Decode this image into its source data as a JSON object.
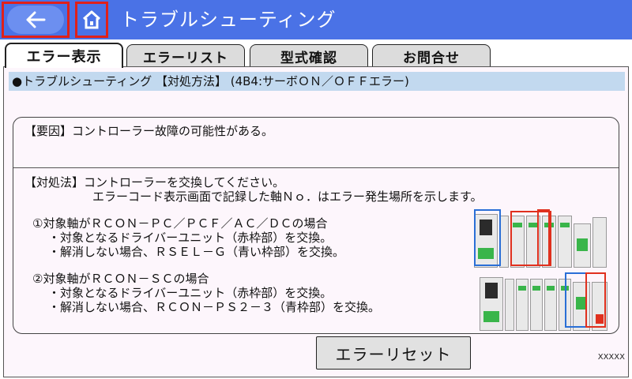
{
  "header": {
    "title": "トラブルシューティング",
    "back_icon": "arrow-left-icon",
    "home_icon": "home-icon",
    "accent_color": "#4a72e6",
    "highlight_color": "#e0201a"
  },
  "tabs": [
    {
      "label": "エラー表示",
      "active": true
    },
    {
      "label": "エラーリスト",
      "active": false
    },
    {
      "label": "型式確認",
      "active": false
    },
    {
      "label": "お問合せ",
      "active": false
    }
  ],
  "breadcrumb": "●トラブルシューティング 【対処方法】 (4B4:サーボＯＮ／ＯＦＦエラー)",
  "cause": "【要因】コントローラー故障の可能性がある。",
  "remedy": {
    "heading": "【対処法】コントローラーを交換してください。",
    "subline": "エラーコード表示画面で記録した軸Ｎｏ．はエラー発生場所を示します。",
    "case1": {
      "title": "①対象軸がＲＣＯＮ－ＰＣ／ＰＣＦ／ＡＣ／ＤＣの場合",
      "item1": "・対象となるドライバーユニット（赤枠部）を交換。",
      "item2": "・解消しない場合、ＲＳＥＬ－Ｇ（青い枠部）を交換。"
    },
    "case2": {
      "title": "②対象軸がＲＣＯＮ－ＳＣの場合",
      "item1": "・対象となるドライバーユニット（赤枠部）を交換。",
      "item2": "・解消しない場合、ＲＣＯＮ－ＰＳ２－３（青枠部）を交換。"
    }
  },
  "reset_button": "エラーリセット",
  "footer_code": "XXXXX"
}
